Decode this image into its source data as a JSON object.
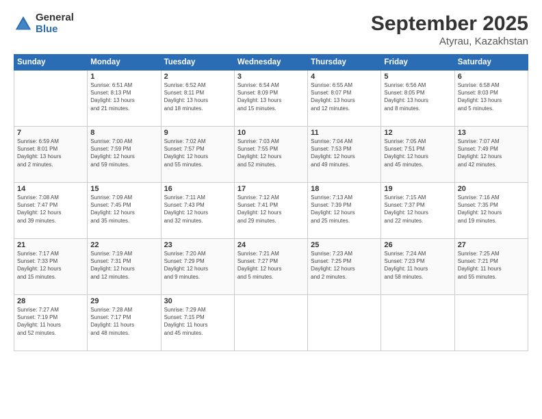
{
  "header": {
    "logo_general": "General",
    "logo_blue": "Blue",
    "main_title": "September 2025",
    "sub_title": "Atyrau, Kazakhstan"
  },
  "days_of_week": [
    "Sunday",
    "Monday",
    "Tuesday",
    "Wednesday",
    "Thursday",
    "Friday",
    "Saturday"
  ],
  "weeks": [
    [
      {
        "day": "",
        "info": ""
      },
      {
        "day": "1",
        "info": "Sunrise: 6:51 AM\nSunset: 8:13 PM\nDaylight: 13 hours\nand 21 minutes."
      },
      {
        "day": "2",
        "info": "Sunrise: 6:52 AM\nSunset: 8:11 PM\nDaylight: 13 hours\nand 18 minutes."
      },
      {
        "day": "3",
        "info": "Sunrise: 6:54 AM\nSunset: 8:09 PM\nDaylight: 13 hours\nand 15 minutes."
      },
      {
        "day": "4",
        "info": "Sunrise: 6:55 AM\nSunset: 8:07 PM\nDaylight: 13 hours\nand 12 minutes."
      },
      {
        "day": "5",
        "info": "Sunrise: 6:56 AM\nSunset: 8:05 PM\nDaylight: 13 hours\nand 8 minutes."
      },
      {
        "day": "6",
        "info": "Sunrise: 6:58 AM\nSunset: 8:03 PM\nDaylight: 13 hours\nand 5 minutes."
      }
    ],
    [
      {
        "day": "7",
        "info": "Sunrise: 6:59 AM\nSunset: 8:01 PM\nDaylight: 13 hours\nand 2 minutes."
      },
      {
        "day": "8",
        "info": "Sunrise: 7:00 AM\nSunset: 7:59 PM\nDaylight: 12 hours\nand 59 minutes."
      },
      {
        "day": "9",
        "info": "Sunrise: 7:02 AM\nSunset: 7:57 PM\nDaylight: 12 hours\nand 55 minutes."
      },
      {
        "day": "10",
        "info": "Sunrise: 7:03 AM\nSunset: 7:55 PM\nDaylight: 12 hours\nand 52 minutes."
      },
      {
        "day": "11",
        "info": "Sunrise: 7:04 AM\nSunset: 7:53 PM\nDaylight: 12 hours\nand 49 minutes."
      },
      {
        "day": "12",
        "info": "Sunrise: 7:05 AM\nSunset: 7:51 PM\nDaylight: 12 hours\nand 45 minutes."
      },
      {
        "day": "13",
        "info": "Sunrise: 7:07 AM\nSunset: 7:49 PM\nDaylight: 12 hours\nand 42 minutes."
      }
    ],
    [
      {
        "day": "14",
        "info": "Sunrise: 7:08 AM\nSunset: 7:47 PM\nDaylight: 12 hours\nand 39 minutes."
      },
      {
        "day": "15",
        "info": "Sunrise: 7:09 AM\nSunset: 7:45 PM\nDaylight: 12 hours\nand 35 minutes."
      },
      {
        "day": "16",
        "info": "Sunrise: 7:11 AM\nSunset: 7:43 PM\nDaylight: 12 hours\nand 32 minutes."
      },
      {
        "day": "17",
        "info": "Sunrise: 7:12 AM\nSunset: 7:41 PM\nDaylight: 12 hours\nand 29 minutes."
      },
      {
        "day": "18",
        "info": "Sunrise: 7:13 AM\nSunset: 7:39 PM\nDaylight: 12 hours\nand 25 minutes."
      },
      {
        "day": "19",
        "info": "Sunrise: 7:15 AM\nSunset: 7:37 PM\nDaylight: 12 hours\nand 22 minutes."
      },
      {
        "day": "20",
        "info": "Sunrise: 7:16 AM\nSunset: 7:35 PM\nDaylight: 12 hours\nand 19 minutes."
      }
    ],
    [
      {
        "day": "21",
        "info": "Sunrise: 7:17 AM\nSunset: 7:33 PM\nDaylight: 12 hours\nand 15 minutes."
      },
      {
        "day": "22",
        "info": "Sunrise: 7:19 AM\nSunset: 7:31 PM\nDaylight: 12 hours\nand 12 minutes."
      },
      {
        "day": "23",
        "info": "Sunrise: 7:20 AM\nSunset: 7:29 PM\nDaylight: 12 hours\nand 9 minutes."
      },
      {
        "day": "24",
        "info": "Sunrise: 7:21 AM\nSunset: 7:27 PM\nDaylight: 12 hours\nand 5 minutes."
      },
      {
        "day": "25",
        "info": "Sunrise: 7:23 AM\nSunset: 7:25 PM\nDaylight: 12 hours\nand 2 minutes."
      },
      {
        "day": "26",
        "info": "Sunrise: 7:24 AM\nSunset: 7:23 PM\nDaylight: 11 hours\nand 58 minutes."
      },
      {
        "day": "27",
        "info": "Sunrise: 7:25 AM\nSunset: 7:21 PM\nDaylight: 11 hours\nand 55 minutes."
      }
    ],
    [
      {
        "day": "28",
        "info": "Sunrise: 7:27 AM\nSunset: 7:19 PM\nDaylight: 11 hours\nand 52 minutes."
      },
      {
        "day": "29",
        "info": "Sunrise: 7:28 AM\nSunset: 7:17 PM\nDaylight: 11 hours\nand 48 minutes."
      },
      {
        "day": "30",
        "info": "Sunrise: 7:29 AM\nSunset: 7:15 PM\nDaylight: 11 hours\nand 45 minutes."
      },
      {
        "day": "",
        "info": ""
      },
      {
        "day": "",
        "info": ""
      },
      {
        "day": "",
        "info": ""
      },
      {
        "day": "",
        "info": ""
      }
    ]
  ]
}
